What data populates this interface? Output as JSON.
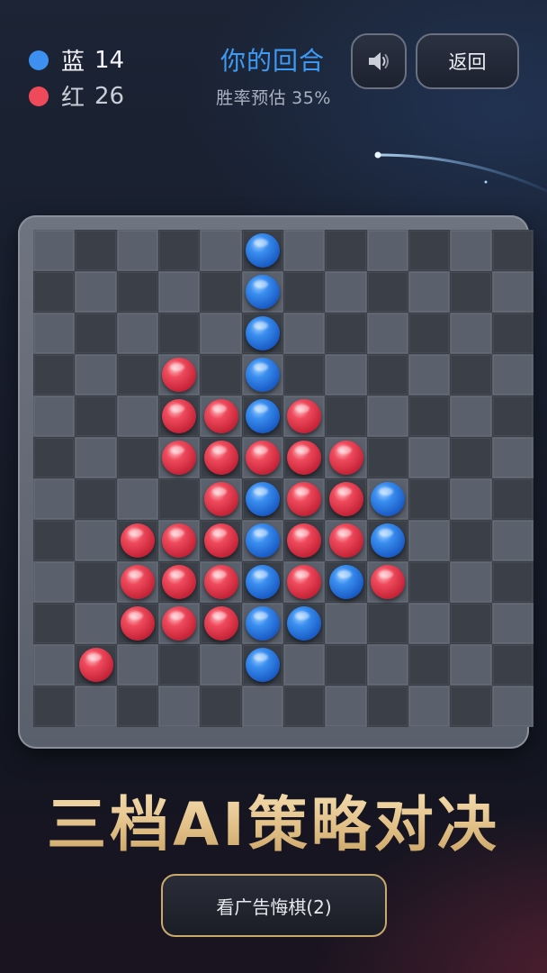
{
  "score": {
    "blue": {
      "label": "蓝",
      "value": "14",
      "color": "#3d8ff0"
    },
    "red": {
      "label": "红",
      "value": "26",
      "color": "#ef4a5a"
    }
  },
  "turn": {
    "title": "你的回合",
    "winrate_label": "胜率预估",
    "winrate_value": "35%"
  },
  "buttons": {
    "sound_icon": "speaker-icon",
    "back_label": "返回",
    "undo_label": "看广告悔棋(2)"
  },
  "tagline": "三档AI策略对决",
  "board": {
    "rows": 12,
    "cols": 12,
    "pieces": [
      {
        "row": 0,
        "col": 5,
        "color": "blue"
      },
      {
        "row": 1,
        "col": 5,
        "color": "blue"
      },
      {
        "row": 2,
        "col": 5,
        "color": "blue"
      },
      {
        "row": 3,
        "col": 3,
        "color": "red"
      },
      {
        "row": 3,
        "col": 5,
        "color": "blue"
      },
      {
        "row": 4,
        "col": 3,
        "color": "red"
      },
      {
        "row": 4,
        "col": 4,
        "color": "red"
      },
      {
        "row": 4,
        "col": 5,
        "color": "blue"
      },
      {
        "row": 4,
        "col": 6,
        "color": "red"
      },
      {
        "row": 5,
        "col": 3,
        "color": "red"
      },
      {
        "row": 5,
        "col": 4,
        "color": "red"
      },
      {
        "row": 5,
        "col": 5,
        "color": "red"
      },
      {
        "row": 5,
        "col": 6,
        "color": "red"
      },
      {
        "row": 5,
        "col": 7,
        "color": "red"
      },
      {
        "row": 6,
        "col": 4,
        "color": "red"
      },
      {
        "row": 6,
        "col": 5,
        "color": "blue"
      },
      {
        "row": 6,
        "col": 6,
        "color": "red"
      },
      {
        "row": 6,
        "col": 7,
        "color": "red"
      },
      {
        "row": 6,
        "col": 8,
        "color": "blue"
      },
      {
        "row": 7,
        "col": 2,
        "color": "red"
      },
      {
        "row": 7,
        "col": 3,
        "color": "red"
      },
      {
        "row": 7,
        "col": 4,
        "color": "red"
      },
      {
        "row": 7,
        "col": 5,
        "color": "blue"
      },
      {
        "row": 7,
        "col": 6,
        "color": "red"
      },
      {
        "row": 7,
        "col": 7,
        "color": "red"
      },
      {
        "row": 7,
        "col": 8,
        "color": "blue"
      },
      {
        "row": 8,
        "col": 2,
        "color": "red"
      },
      {
        "row": 8,
        "col": 3,
        "color": "red"
      },
      {
        "row": 8,
        "col": 4,
        "color": "red"
      },
      {
        "row": 8,
        "col": 5,
        "color": "blue"
      },
      {
        "row": 8,
        "col": 6,
        "color": "red"
      },
      {
        "row": 8,
        "col": 7,
        "color": "blue"
      },
      {
        "row": 8,
        "col": 8,
        "color": "red"
      },
      {
        "row": 9,
        "col": 2,
        "color": "red"
      },
      {
        "row": 9,
        "col": 3,
        "color": "red"
      },
      {
        "row": 9,
        "col": 4,
        "color": "red"
      },
      {
        "row": 9,
        "col": 5,
        "color": "blue"
      },
      {
        "row": 9,
        "col": 6,
        "color": "blue"
      },
      {
        "row": 10,
        "col": 1,
        "color": "red"
      },
      {
        "row": 10,
        "col": 5,
        "color": "blue"
      }
    ]
  }
}
